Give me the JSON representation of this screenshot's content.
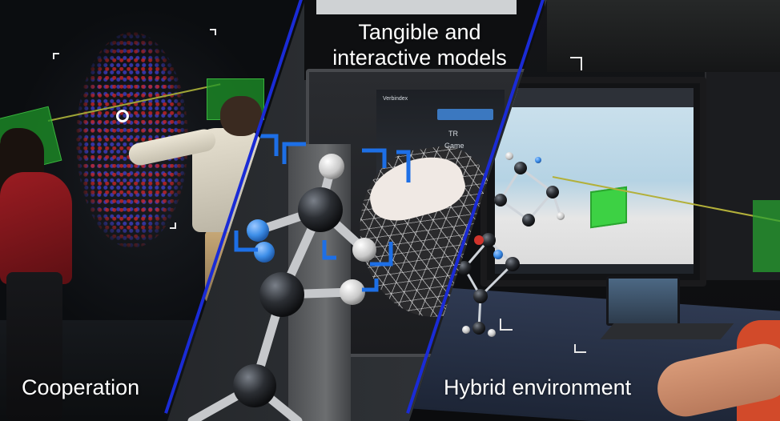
{
  "captions": {
    "left": "Cooperation",
    "top_line1": "Tangible and",
    "top_line2": "interactive models",
    "right": "Hybrid environment"
  },
  "screen": {
    "app_label": "Verbindex",
    "tr_label": "TR",
    "game_label": "Game"
  },
  "colors": {
    "divider": "#1a2bd6",
    "bracket": "#1d6fe6",
    "hologram_cube": "#3dd144",
    "caption_text": "#ffffff"
  }
}
